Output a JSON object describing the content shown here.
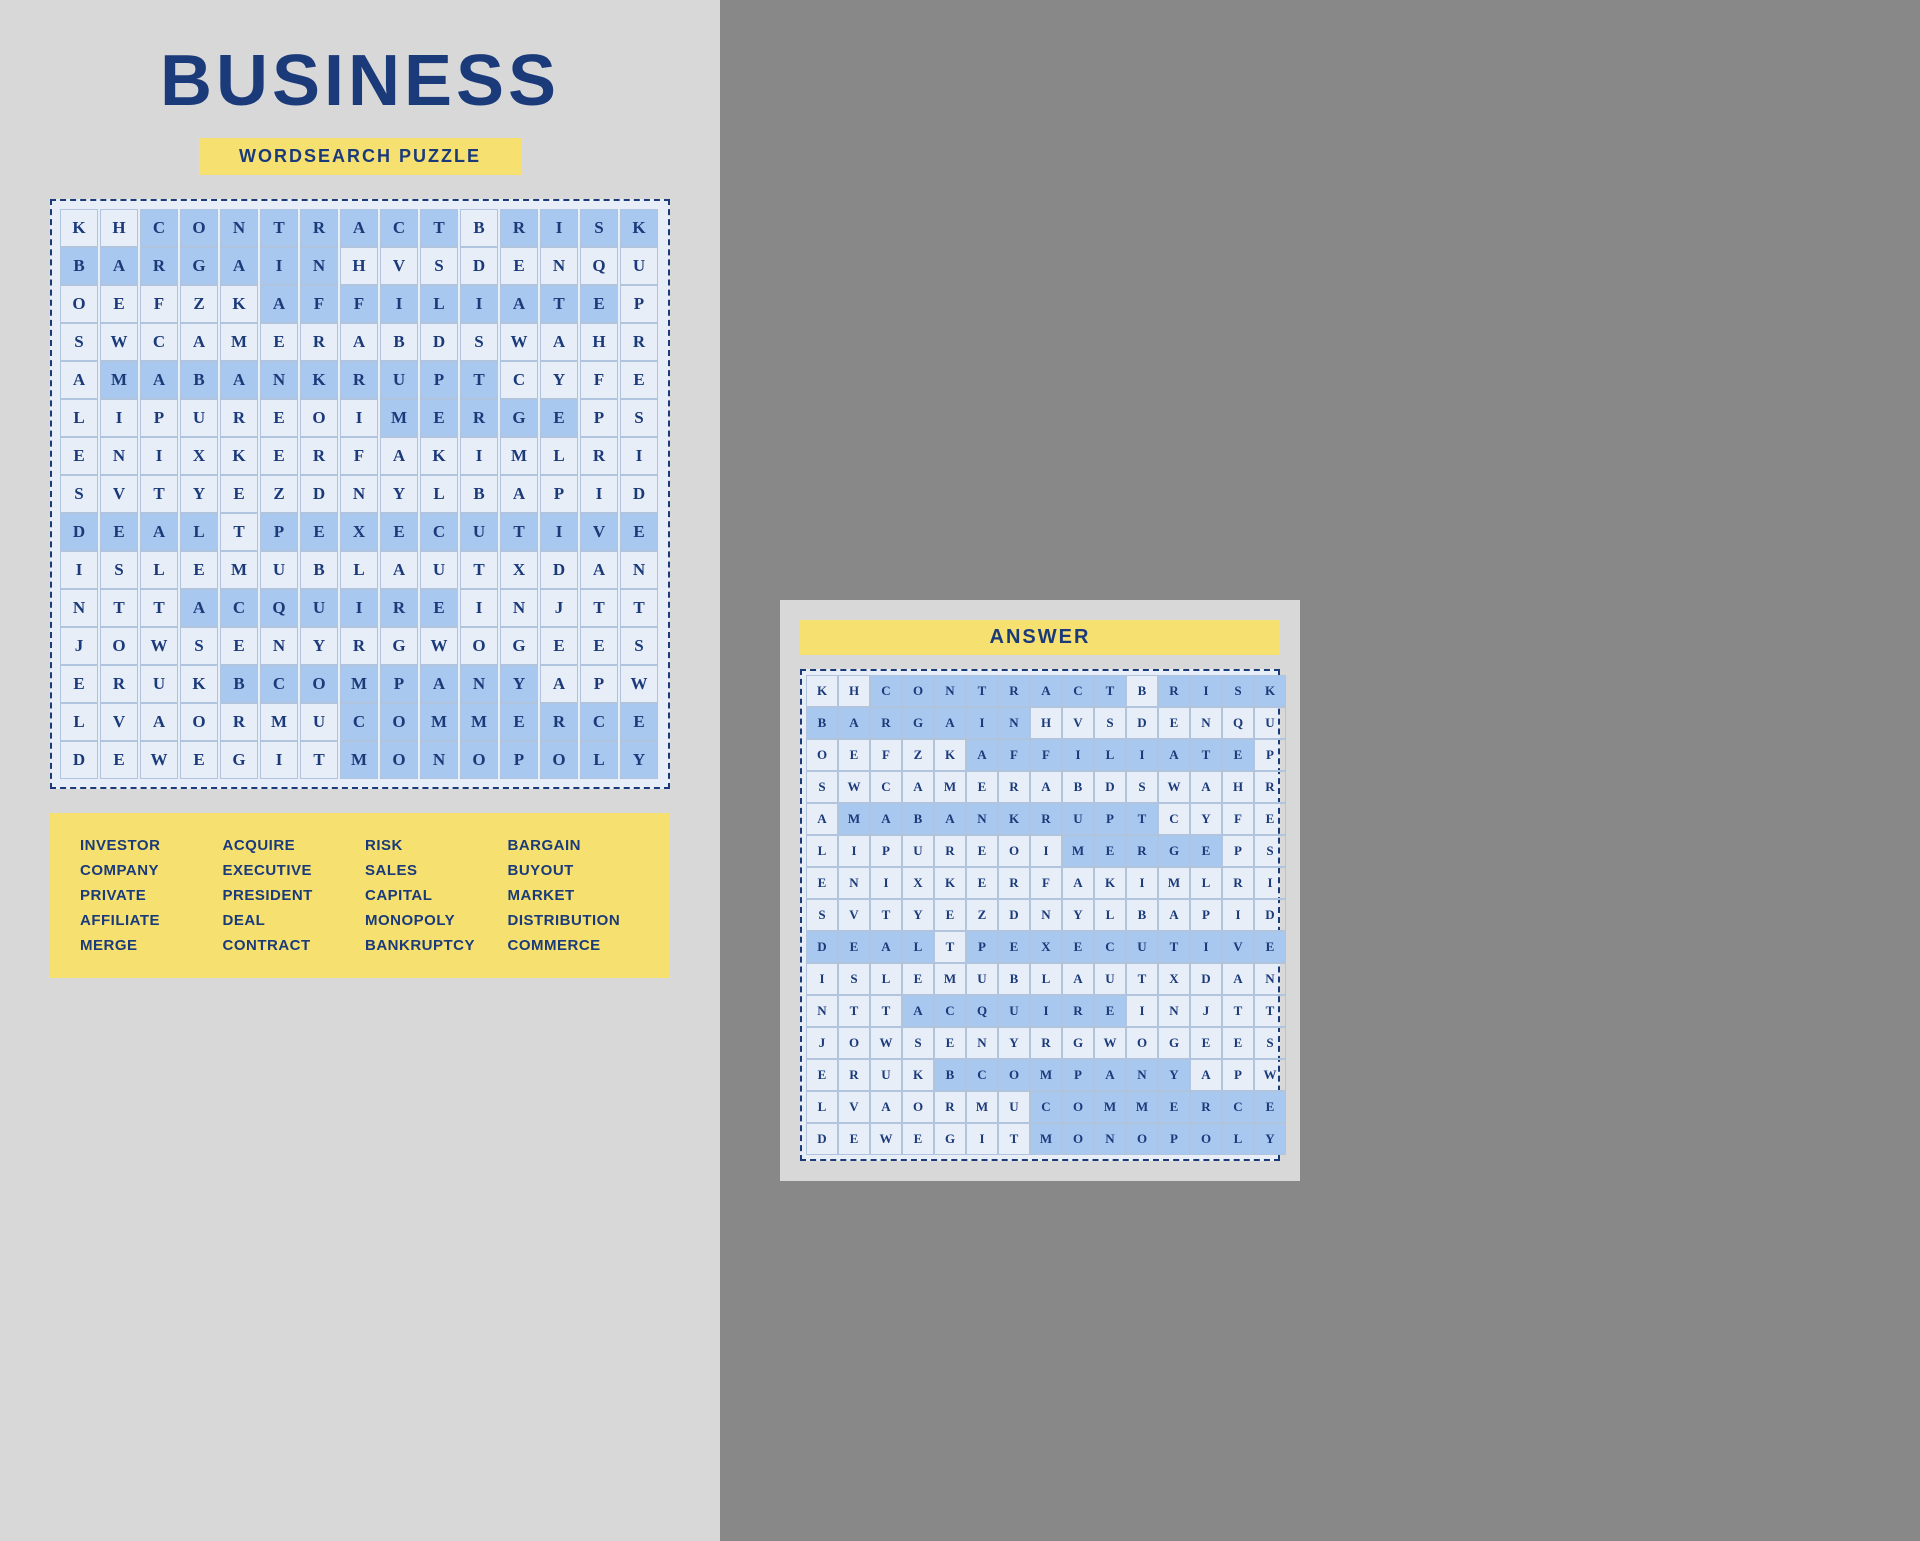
{
  "title": "BUSINESS",
  "subtitle": "WORDSEARCH PUZZLE",
  "answer_title": "ANSWER",
  "grid": [
    [
      "K",
      "H",
      "C",
      "O",
      "N",
      "T",
      "R",
      "A",
      "C",
      "T",
      "B",
      "R",
      "I",
      "S",
      "K"
    ],
    [
      "B",
      "A",
      "R",
      "G",
      "A",
      "I",
      "N",
      "H",
      "V",
      "S",
      "D",
      "E",
      "N",
      "Q",
      "U"
    ],
    [
      "O",
      "E",
      "F",
      "Z",
      "K",
      "A",
      "F",
      "F",
      "I",
      "L",
      "I",
      "A",
      "T",
      "E",
      "P"
    ],
    [
      "S",
      "W",
      "C",
      "A",
      "M",
      "E",
      "R",
      "A",
      "B",
      "D",
      "S",
      "W",
      "A",
      "H",
      "R"
    ],
    [
      "A",
      "M",
      "A",
      "B",
      "A",
      "N",
      "K",
      "R",
      "U",
      "P",
      "T",
      "C",
      "Y",
      "F",
      "E"
    ],
    [
      "L",
      "I",
      "P",
      "U",
      "R",
      "E",
      "O",
      "I",
      "M",
      "E",
      "R",
      "G",
      "E",
      "P",
      "S"
    ],
    [
      "E",
      "N",
      "I",
      "X",
      "K",
      "E",
      "R",
      "F",
      "A",
      "K",
      "I",
      "M",
      "L",
      "R",
      "I"
    ],
    [
      "S",
      "V",
      "T",
      "Y",
      "E",
      "Z",
      "D",
      "N",
      "Y",
      "L",
      "B",
      "A",
      "P",
      "I",
      "D"
    ],
    [
      "D",
      "E",
      "A",
      "L",
      "T",
      "P",
      "E",
      "X",
      "E",
      "C",
      "U",
      "T",
      "I",
      "V",
      "E"
    ],
    [
      "I",
      "S",
      "L",
      "E",
      "M",
      "U",
      "B",
      "L",
      "A",
      "U",
      "T",
      "X",
      "D",
      "A",
      "N"
    ],
    [
      "N",
      "T",
      "T",
      "A",
      "C",
      "Q",
      "U",
      "I",
      "R",
      "E",
      "I",
      "N",
      "J",
      "T",
      "T"
    ],
    [
      "J",
      "O",
      "W",
      "S",
      "E",
      "N",
      "Y",
      "R",
      "G",
      "W",
      "O",
      "G",
      "E",
      "E",
      "S"
    ],
    [
      "E",
      "R",
      "U",
      "K",
      "B",
      "C",
      "O",
      "M",
      "P",
      "A",
      "N",
      "Y",
      "A",
      "P",
      "W"
    ],
    [
      "L",
      "V",
      "A",
      "O",
      "R",
      "M",
      "U",
      "C",
      "O",
      "M",
      "M",
      "E",
      "R",
      "C",
      "E"
    ],
    [
      "D",
      "E",
      "W",
      "E",
      "G",
      "I",
      "T",
      "M",
      "O",
      "N",
      "O",
      "P",
      "O",
      "L",
      "Y"
    ]
  ],
  "highlighted_cells": {
    "CONTRACT": [
      [
        0,
        2
      ],
      [
        0,
        3
      ],
      [
        0,
        4
      ],
      [
        0,
        5
      ],
      [
        0,
        6
      ],
      [
        0,
        7
      ],
      [
        0,
        8
      ],
      [
        0,
        9
      ]
    ],
    "RISK": [
      [
        0,
        11
      ],
      [
        0,
        12
      ],
      [
        0,
        13
      ],
      [
        0,
        14
      ]
    ],
    "BARGAIN": [
      [
        1,
        0
      ],
      [
        1,
        1
      ],
      [
        1,
        2
      ],
      [
        1,
        3
      ],
      [
        1,
        4
      ],
      [
        1,
        5
      ],
      [
        1,
        6
      ]
    ],
    "AFFILIATE": [
      [
        2,
        5
      ],
      [
        2,
        6
      ],
      [
        2,
        7
      ],
      [
        2,
        8
      ],
      [
        2,
        9
      ],
      [
        2,
        10
      ],
      [
        2,
        11
      ],
      [
        2,
        12
      ],
      [
        2,
        13
      ]
    ],
    "BANKRUPT": [
      [
        4,
        1
      ],
      [
        4,
        2
      ],
      [
        4,
        3
      ],
      [
        4,
        4
      ],
      [
        4,
        5
      ],
      [
        4,
        6
      ],
      [
        4,
        7
      ],
      [
        4,
        8
      ],
      [
        4,
        9
      ],
      [
        4,
        10
      ]
    ],
    "MERGE": [
      [
        5,
        8
      ],
      [
        5,
        9
      ],
      [
        5,
        10
      ],
      [
        5,
        11
      ],
      [
        5,
        12
      ]
    ],
    "DEAL": [
      [
        8,
        0
      ],
      [
        8,
        1
      ],
      [
        8,
        2
      ],
      [
        8,
        3
      ]
    ],
    "EXECUTIVE": [
      [
        8,
        5
      ],
      [
        8,
        6
      ],
      [
        8,
        7
      ],
      [
        8,
        8
      ],
      [
        8,
        9
      ],
      [
        8,
        10
      ],
      [
        8,
        11
      ],
      [
        8,
        12
      ],
      [
        8,
        13
      ],
      [
        8,
        14
      ]
    ],
    "ACQUIRE": [
      [
        10,
        3
      ],
      [
        10,
        4
      ],
      [
        10,
        5
      ],
      [
        10,
        6
      ],
      [
        10,
        7
      ],
      [
        10,
        8
      ],
      [
        10,
        9
      ]
    ],
    "COMPANY": [
      [
        12,
        4
      ],
      [
        12,
        5
      ],
      [
        12,
        6
      ],
      [
        12,
        7
      ],
      [
        12,
        8
      ],
      [
        12,
        9
      ],
      [
        12,
        10
      ],
      [
        12,
        11
      ]
    ],
    "COMMERCE": [
      [
        13,
        7
      ],
      [
        13,
        8
      ],
      [
        13,
        9
      ],
      [
        13,
        10
      ],
      [
        13,
        11
      ],
      [
        13,
        12
      ],
      [
        13,
        13
      ],
      [
        13,
        14
      ]
    ],
    "MONOPOLY": [
      [
        14,
        7
      ],
      [
        14,
        8
      ],
      [
        14,
        9
      ],
      [
        14,
        10
      ],
      [
        14,
        11
      ],
      [
        14,
        12
      ],
      [
        14,
        13
      ],
      [
        14,
        14
      ]
    ],
    "CAPITAL": [
      [
        5,
        0
      ]
    ],
    "CONTRACT2": [
      [
        13,
        0
      ]
    ]
  },
  "answer_highlighted": {
    "positions": [
      [
        0,
        2
      ],
      [
        0,
        3
      ],
      [
        0,
        4
      ],
      [
        0,
        5
      ],
      [
        0,
        6
      ],
      [
        0,
        7
      ],
      [
        0,
        8
      ],
      [
        0,
        9
      ],
      [
        0,
        11
      ],
      [
        0,
        12
      ],
      [
        0,
        13
      ],
      [
        0,
        14
      ],
      [
        1,
        0
      ],
      [
        1,
        1
      ],
      [
        1,
        2
      ],
      [
        1,
        3
      ],
      [
        1,
        4
      ],
      [
        1,
        5
      ],
      [
        1,
        6
      ],
      [
        2,
        5
      ],
      [
        2,
        6
      ],
      [
        2,
        7
      ],
      [
        2,
        8
      ],
      [
        2,
        9
      ],
      [
        2,
        10
      ],
      [
        2,
        11
      ],
      [
        2,
        12
      ],
      [
        2,
        13
      ],
      [
        4,
        1
      ],
      [
        4,
        2
      ],
      [
        4,
        3
      ],
      [
        4,
        4
      ],
      [
        4,
        5
      ],
      [
        4,
        6
      ],
      [
        4,
        7
      ],
      [
        4,
        8
      ],
      [
        4,
        9
      ],
      [
        4,
        10
      ],
      [
        5,
        8
      ],
      [
        5,
        9
      ],
      [
        5,
        10
      ],
      [
        5,
        11
      ],
      [
        5,
        12
      ],
      [
        8,
        0
      ],
      [
        8,
        1
      ],
      [
        8,
        2
      ],
      [
        8,
        3
      ],
      [
        8,
        5
      ],
      [
        8,
        6
      ],
      [
        8,
        7
      ],
      [
        8,
        8
      ],
      [
        8,
        9
      ],
      [
        8,
        10
      ],
      [
        8,
        11
      ],
      [
        8,
        12
      ],
      [
        8,
        13
      ],
      [
        8,
        14
      ],
      [
        10,
        3
      ],
      [
        10,
        4
      ],
      [
        10,
        5
      ],
      [
        10,
        6
      ],
      [
        10,
        7
      ],
      [
        10,
        8
      ],
      [
        10,
        9
      ],
      [
        12,
        4
      ],
      [
        12,
        5
      ],
      [
        12,
        6
      ],
      [
        12,
        7
      ],
      [
        12,
        8
      ],
      [
        12,
        9
      ],
      [
        12,
        10
      ],
      [
        12,
        11
      ],
      [
        13,
        7
      ],
      [
        13,
        8
      ],
      [
        13,
        9
      ],
      [
        13,
        10
      ],
      [
        13,
        11
      ],
      [
        13,
        12
      ],
      [
        13,
        13
      ],
      [
        13,
        14
      ],
      [
        14,
        7
      ],
      [
        14,
        8
      ],
      [
        14,
        9
      ],
      [
        14,
        10
      ],
      [
        14,
        11
      ],
      [
        14,
        12
      ],
      [
        14,
        13
      ],
      [
        14,
        14
      ]
    ]
  },
  "word_list": [
    [
      "INVESTOR",
      "ACQUIRE",
      "RISK",
      "BARGAIN"
    ],
    [
      "COMPANY",
      "EXECUTIVE",
      "SALES",
      "BUYOUT"
    ],
    [
      "PRIVATE",
      "PRESIDENT",
      "CAPITAL",
      "MARKET"
    ],
    [
      "AFFILIATE",
      "DEAL",
      "MONOPOLY",
      "DISTRIBUTION"
    ],
    [
      "MERGE",
      "CONTRACT",
      "BANKRUPTCY",
      "COMMERCE"
    ]
  ]
}
